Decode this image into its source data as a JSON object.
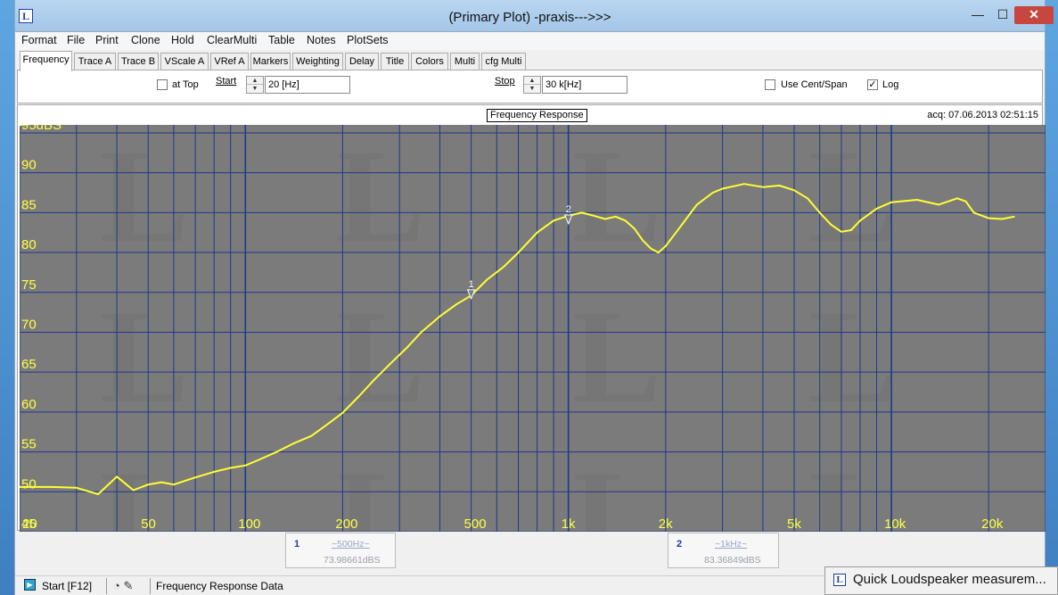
{
  "window": {
    "title": "(Primary Plot) -praxis--->>>",
    "icon_letter": "L",
    "minimize_glyph": "—",
    "maximize_glyph": "☐",
    "close_glyph": "✕"
  },
  "menu": [
    "Format",
    "File",
    "Print",
    "Clone",
    "Hold",
    "ClearMulti",
    "Table",
    "Notes",
    "PlotSets"
  ],
  "tabs": [
    {
      "label": "Frequency",
      "active": true
    },
    {
      "label": "Trace A"
    },
    {
      "label": "Trace B"
    },
    {
      "label": "VScale A"
    },
    {
      "label": "VRef A"
    },
    {
      "label": "Markers"
    },
    {
      "label": "Weighting"
    },
    {
      "label": "Delay"
    },
    {
      "label": "Title"
    },
    {
      "label": "Colors"
    },
    {
      "label": "Multi"
    },
    {
      "label": "cfg Multi"
    }
  ],
  "frequency_panel": {
    "at_top_label": "at Top",
    "at_top_checked": false,
    "start_label": "Start",
    "start_value": "20 [Hz]",
    "stop_label": "Stop",
    "stop_value": "30 k[Hz]",
    "cent_span_label": "Use Cent/Span",
    "cent_span_checked": false,
    "log_label": "Log",
    "log_checked": true,
    "check_glyph": "✓"
  },
  "plot": {
    "title_box": "Frequency Response",
    "acq": "acq: 07.06.2013 02:51:15"
  },
  "chart_data": {
    "type": "line",
    "title": "Frequency Response",
    "x_scale": "log",
    "xlim": [
      20,
      30000
    ],
    "ylim": [
      45,
      95
    ],
    "y_unit_label": "dBS",
    "grid": true,
    "y_tick_labels": [
      "95dBS",
      "90",
      "85",
      "80",
      "75",
      "70",
      "65",
      "60",
      "55",
      "50",
      "45"
    ],
    "x_tick_labels": [
      {
        "value": 20,
        "label": "20"
      },
      {
        "value": 50,
        "label": "50"
      },
      {
        "value": 100,
        "label": "100"
      },
      {
        "value": 200,
        "label": "200"
      },
      {
        "value": 500,
        "label": "500"
      },
      {
        "value": 1000,
        "label": "1k"
      },
      {
        "value": 2000,
        "label": "2k"
      },
      {
        "value": 5000,
        "label": "5k"
      },
      {
        "value": 10000,
        "label": "10k"
      },
      {
        "value": 20000,
        "label": "20k"
      }
    ],
    "series": [
      {
        "color": "#ffff33",
        "points": [
          [
            20,
            50.6
          ],
          [
            25,
            50.6
          ],
          [
            30,
            50.5
          ],
          [
            35,
            49.7
          ],
          [
            40,
            51.9
          ],
          [
            45,
            50.2
          ],
          [
            50,
            50.9
          ],
          [
            55,
            51.2
          ],
          [
            60,
            50.9
          ],
          [
            70,
            51.8
          ],
          [
            80,
            52.5
          ],
          [
            90,
            53.0
          ],
          [
            100,
            53.3
          ],
          [
            110,
            54.0
          ],
          [
            125,
            55.0
          ],
          [
            140,
            56.0
          ],
          [
            160,
            57.0
          ],
          [
            180,
            58.5
          ],
          [
            200,
            59.9
          ],
          [
            225,
            62.0
          ],
          [
            250,
            64.0
          ],
          [
            280,
            66.0
          ],
          [
            315,
            68.0
          ],
          [
            350,
            70.0
          ],
          [
            400,
            72.0
          ],
          [
            450,
            73.5
          ],
          [
            500,
            74.6
          ],
          [
            560,
            76.6
          ],
          [
            630,
            78.2
          ],
          [
            700,
            80.0
          ],
          [
            800,
            82.5
          ],
          [
            900,
            84.0
          ],
          [
            1000,
            84.6
          ],
          [
            1100,
            85.0
          ],
          [
            1200,
            84.6
          ],
          [
            1300,
            84.2
          ],
          [
            1400,
            84.5
          ],
          [
            1500,
            84.0
          ],
          [
            1600,
            83.0
          ],
          [
            1700,
            81.5
          ],
          [
            1800,
            80.5
          ],
          [
            1900,
            80.0
          ],
          [
            2000,
            80.8
          ],
          [
            2200,
            83.0
          ],
          [
            2500,
            86.0
          ],
          [
            2800,
            87.5
          ],
          [
            3000,
            88.0
          ],
          [
            3500,
            88.6
          ],
          [
            4000,
            88.2
          ],
          [
            4500,
            88.4
          ],
          [
            5000,
            87.8
          ],
          [
            5500,
            86.8
          ],
          [
            6000,
            85.0
          ],
          [
            6500,
            83.5
          ],
          [
            7000,
            82.6
          ],
          [
            7500,
            82.8
          ],
          [
            8000,
            84.0
          ],
          [
            9000,
            85.5
          ],
          [
            10000,
            86.3
          ],
          [
            12000,
            86.6
          ],
          [
            14000,
            86.0
          ],
          [
            16000,
            86.8
          ],
          [
            17000,
            86.4
          ],
          [
            18000,
            85.0
          ],
          [
            20000,
            84.3
          ],
          [
            22000,
            84.2
          ],
          [
            24000,
            84.5
          ]
        ]
      }
    ],
    "markers": [
      {
        "label": "1",
        "x": 500,
        "y": 73.98661
      },
      {
        "label": "2",
        "x": 1000,
        "y": 83.36849
      }
    ]
  },
  "cursors": [
    {
      "num": "1",
      "freq": "~500Hz~",
      "value": "73.98661dBS"
    },
    {
      "num": "2",
      "freq": "~1kHz~",
      "value": "83.36849dBS"
    }
  ],
  "status": {
    "start_label": "Start [F12]",
    "start_glyph": "▶",
    "icons_text": "◔ ✎",
    "message": "Frequency Response Data"
  },
  "taskbar_popup": {
    "text": "Quick Loudspeaker measurem..."
  }
}
